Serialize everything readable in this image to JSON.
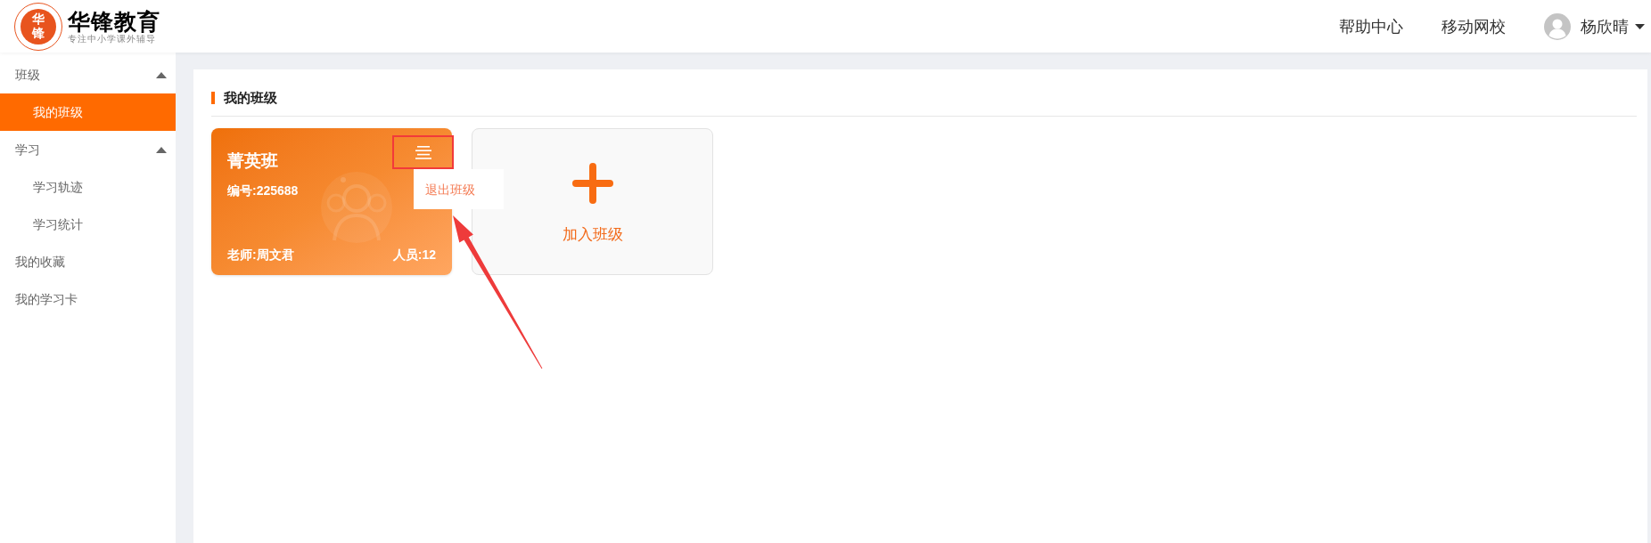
{
  "header": {
    "logo": {
      "mark": "华锋",
      "title": "华锋教育",
      "slogan": "专注中小学课外辅导"
    },
    "nav": [
      {
        "label": "帮助中心"
      },
      {
        "label": "移动网校"
      }
    ],
    "user": {
      "name": "杨欣晴"
    }
  },
  "sidebar": {
    "items": [
      {
        "kind": "group",
        "label": "班级",
        "expanded": true,
        "children": [
          {
            "label": "我的班级",
            "selected": true
          }
        ]
      },
      {
        "kind": "group",
        "label": "学习",
        "expanded": true,
        "children": [
          {
            "label": "学习轨迹",
            "selected": false
          },
          {
            "label": "学习统计",
            "selected": false
          }
        ]
      },
      {
        "kind": "link",
        "label": "我的收藏",
        "selected": false
      },
      {
        "kind": "link",
        "label": "我的学习卡",
        "selected": false
      }
    ]
  },
  "content": {
    "title": "我的班级",
    "classes": [
      {
        "name": "菁英班",
        "code": "编号:225688",
        "teacher": "老师:周文君",
        "members": "人员:12",
        "menu_highlighted": true,
        "menu_open": true,
        "menu_items": [
          {
            "label": "退出班级"
          }
        ]
      }
    ],
    "join_card": {
      "label": "加入班级"
    }
  },
  "annotation": {
    "arrow": true
  }
}
